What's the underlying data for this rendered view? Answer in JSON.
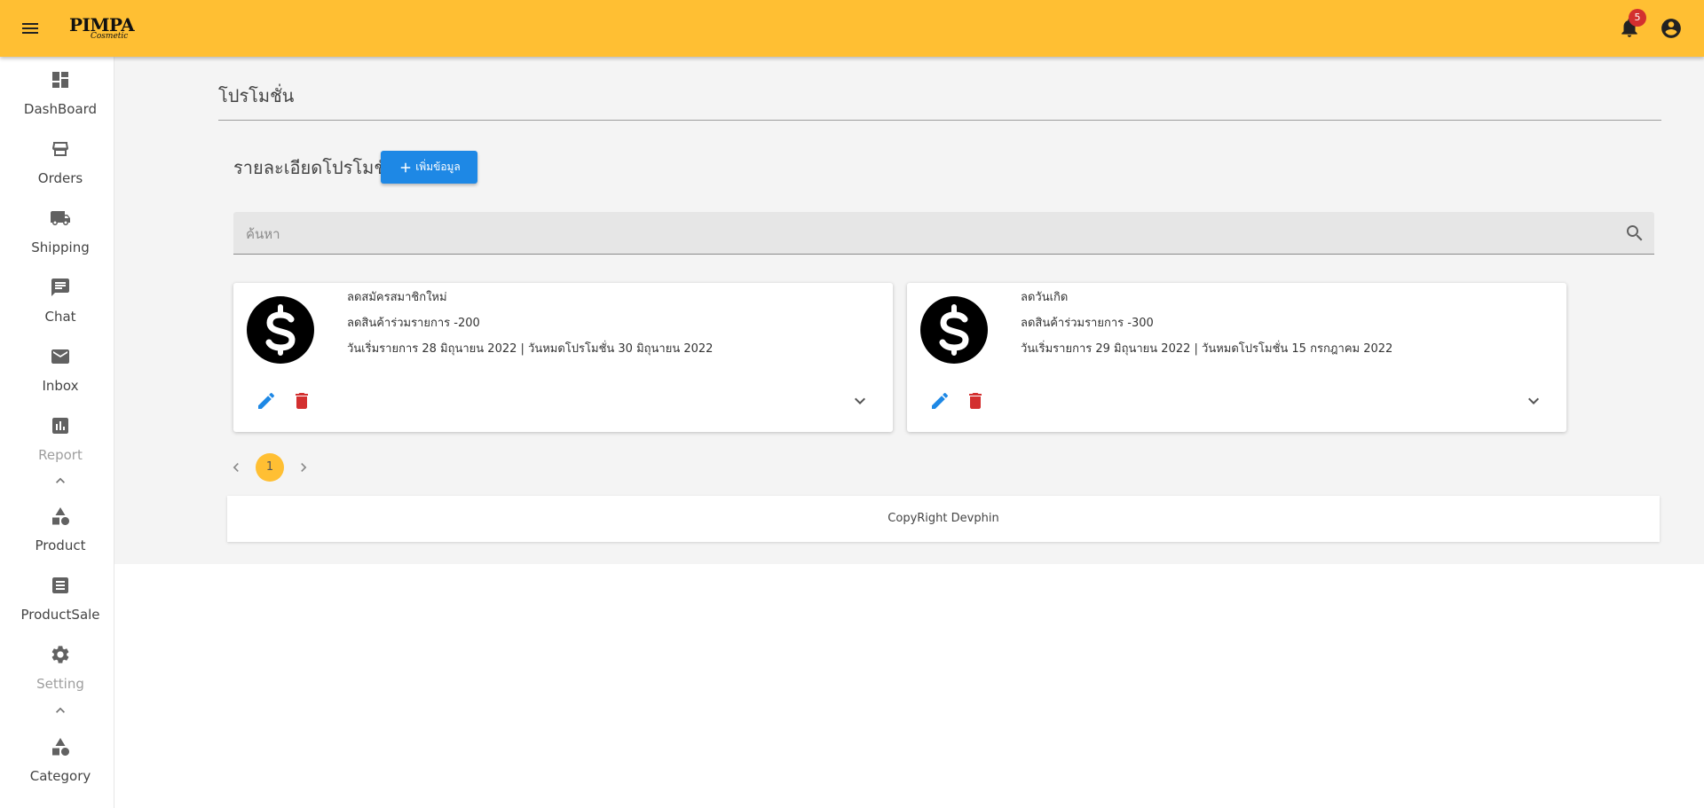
{
  "header": {
    "logo_text": "PIMPA",
    "logo_subtext": "Cosmetic",
    "notification_count": "5"
  },
  "sidebar": {
    "items": [
      {
        "label": "DashBoard",
        "icon": "dashboard-icon"
      },
      {
        "label": "Orders",
        "icon": "store-icon"
      },
      {
        "label": "Shipping",
        "icon": "truck-icon"
      },
      {
        "label": "Chat",
        "icon": "chat-icon"
      },
      {
        "label": "Inbox",
        "icon": "mail-icon"
      },
      {
        "label": "Report",
        "icon": "report-icon"
      },
      {
        "label": "Product",
        "icon": "category-icon"
      },
      {
        "label": "ProductSale",
        "icon": "list-icon"
      },
      {
        "label": "Setting",
        "icon": "gear-icon"
      },
      {
        "label": "Category",
        "icon": "category-icon"
      }
    ]
  },
  "page": {
    "title": "โปรโมชั่น",
    "section_title": "รายละเอียดโปรโมชั่น",
    "add_button": "เพิ่มข้อมูล"
  },
  "search": {
    "placeholder": "ค้นหา"
  },
  "promotions": [
    {
      "name": "ลดสมัครสมาชิกใหม่",
      "discount": "ลดสินค้าร่วมรายการ -200",
      "dates": "วันเริ่มรายการ 28 มิถุนายน 2022 | วันหมดโปรโมชั่น 30 มิถุนายน 2022"
    },
    {
      "name": "ลดวันเกิด",
      "discount": "ลดสินค้าร่วมรายการ -300",
      "dates": "วันเริ่มรายการ 29 มิถุนายน 2022 | วันหมดโปรโมชั่น 15 กรกฎาคม 2022"
    }
  ],
  "pagination": {
    "current_page": "1"
  },
  "footer": {
    "text": "CopyRight Devphin"
  },
  "colors": {
    "topbar": "#ffbf33",
    "primary": "#1e88e5",
    "danger": "#d32f2f"
  }
}
